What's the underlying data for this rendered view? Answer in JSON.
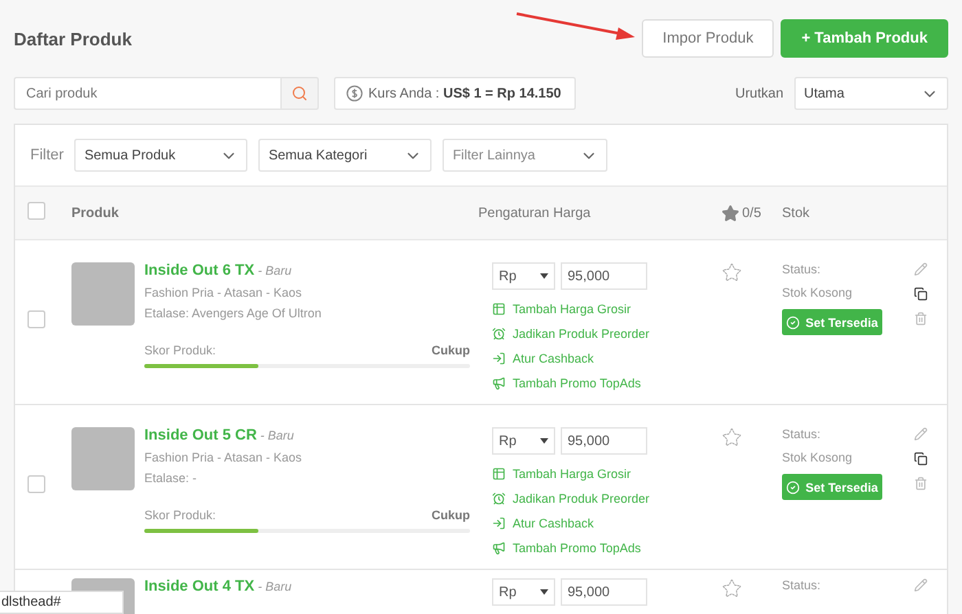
{
  "header": {
    "title": "Daftar Produk",
    "import_button": "Impor Produk",
    "add_button": "+ Tambah Produk"
  },
  "toolbar": {
    "search": {
      "placeholder": "Cari produk"
    },
    "currency": {
      "label": "Kurs Anda : ",
      "value": "US$ 1 = Rp 14.150"
    },
    "sort": {
      "label": "Urutkan",
      "value": "Utama"
    }
  },
  "filters": {
    "label": "Filter",
    "dropdowns": [
      {
        "value": "Semua Produk",
        "kind": "value"
      },
      {
        "value": "Semua Kategori",
        "kind": "value"
      },
      {
        "placeholder": "Filter Lainnya",
        "kind": "placeholder"
      }
    ]
  },
  "table": {
    "select_all_checked": false,
    "columns": {
      "product": "Produk",
      "price": "Pengaturan Harga",
      "rating": "0/5",
      "stock": "Stok"
    },
    "rows": [
      {
        "checked": false,
        "name": "Inside Out 6 TX",
        "condition": " - Baru",
        "category": "Fashion Pria - Atasan - Kaos",
        "etalase": "Etalase:  Avengers Age Of Ultron",
        "score_label": "Skor Produk:",
        "score_value": "Cukup",
        "level": 0.35,
        "currency": "Rp",
        "price": "95,000",
        "actions": [
          {
            "kind": "wholesale",
            "label": "Tambah Harga Grosir"
          },
          {
            "kind": "preorder",
            "label": "Jadikan Produk Preorder"
          },
          {
            "kind": "cashback",
            "label": "Atur Cashback"
          },
          {
            "kind": "promo",
            "label": "Tambah Promo TopAds"
          }
        ],
        "status_label": "Status:",
        "status_value": "Stok Kosong",
        "stock_button": "Set Tersedia"
      },
      {
        "checked": false,
        "name": "Inside Out 5 CR",
        "condition": " - Baru",
        "category": "Fashion Pria - Atasan - Kaos",
        "etalase": "Etalase:  -",
        "score_label": "Skor Produk:",
        "score_value": "Cukup",
        "level": 0.35,
        "currency": "Rp",
        "price": "95,000",
        "actions": [
          {
            "kind": "wholesale",
            "label": "Tambah Harga Grosir"
          },
          {
            "kind": "preorder",
            "label": "Jadikan Produk Preorder"
          },
          {
            "kind": "cashback",
            "label": "Atur Cashback"
          },
          {
            "kind": "promo",
            "label": "Tambah Promo TopAds"
          }
        ],
        "status_label": "Status:",
        "status_value": "Stok Kosong",
        "stock_button": "Set Tersedia"
      },
      {
        "name": "Inside Out 4 TX",
        "condition": " - Baru",
        "currency": "Rp",
        "price": "95,000",
        "status_label": "Status:"
      }
    ]
  },
  "status_bar": {
    "url": "dlsthead#"
  }
}
